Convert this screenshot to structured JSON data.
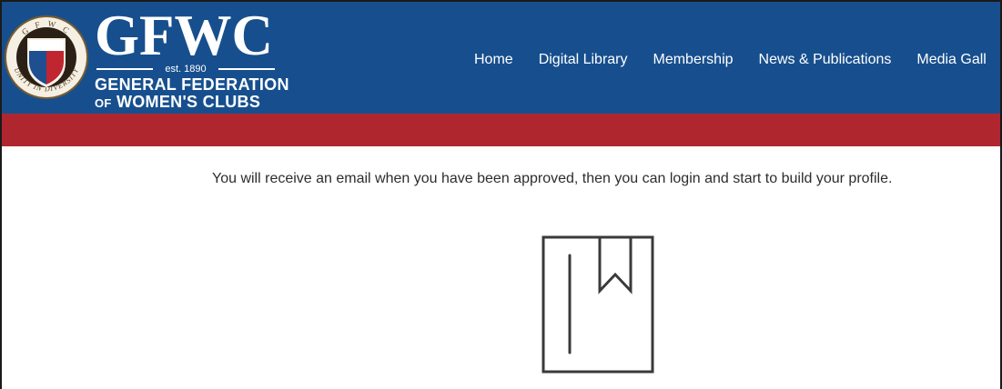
{
  "brand": {
    "name": "GFWC",
    "established": "est. 1890",
    "line1": "GENERAL FEDERATION",
    "line2_prefix": "OF",
    "line2_main": "WOMEN'S CLUBS",
    "seal_text_top": "G F W C",
    "seal_text_bottom": "UNITY IN DIVERSITY"
  },
  "nav": {
    "items": [
      {
        "label": "Home"
      },
      {
        "label": "Digital Library"
      },
      {
        "label": "Membership"
      },
      {
        "label": "News & Publications"
      },
      {
        "label": "Media Gall"
      }
    ]
  },
  "main": {
    "message": "You will receive an email when you have been approved, then you can login and start to build your profile.",
    "icon": "bookmark-book-icon"
  },
  "colors": {
    "header_blue": "#174f8e",
    "band_red": "#b0262f",
    "text": "#2d2d2d",
    "icon_stroke": "#3a3a3a"
  }
}
